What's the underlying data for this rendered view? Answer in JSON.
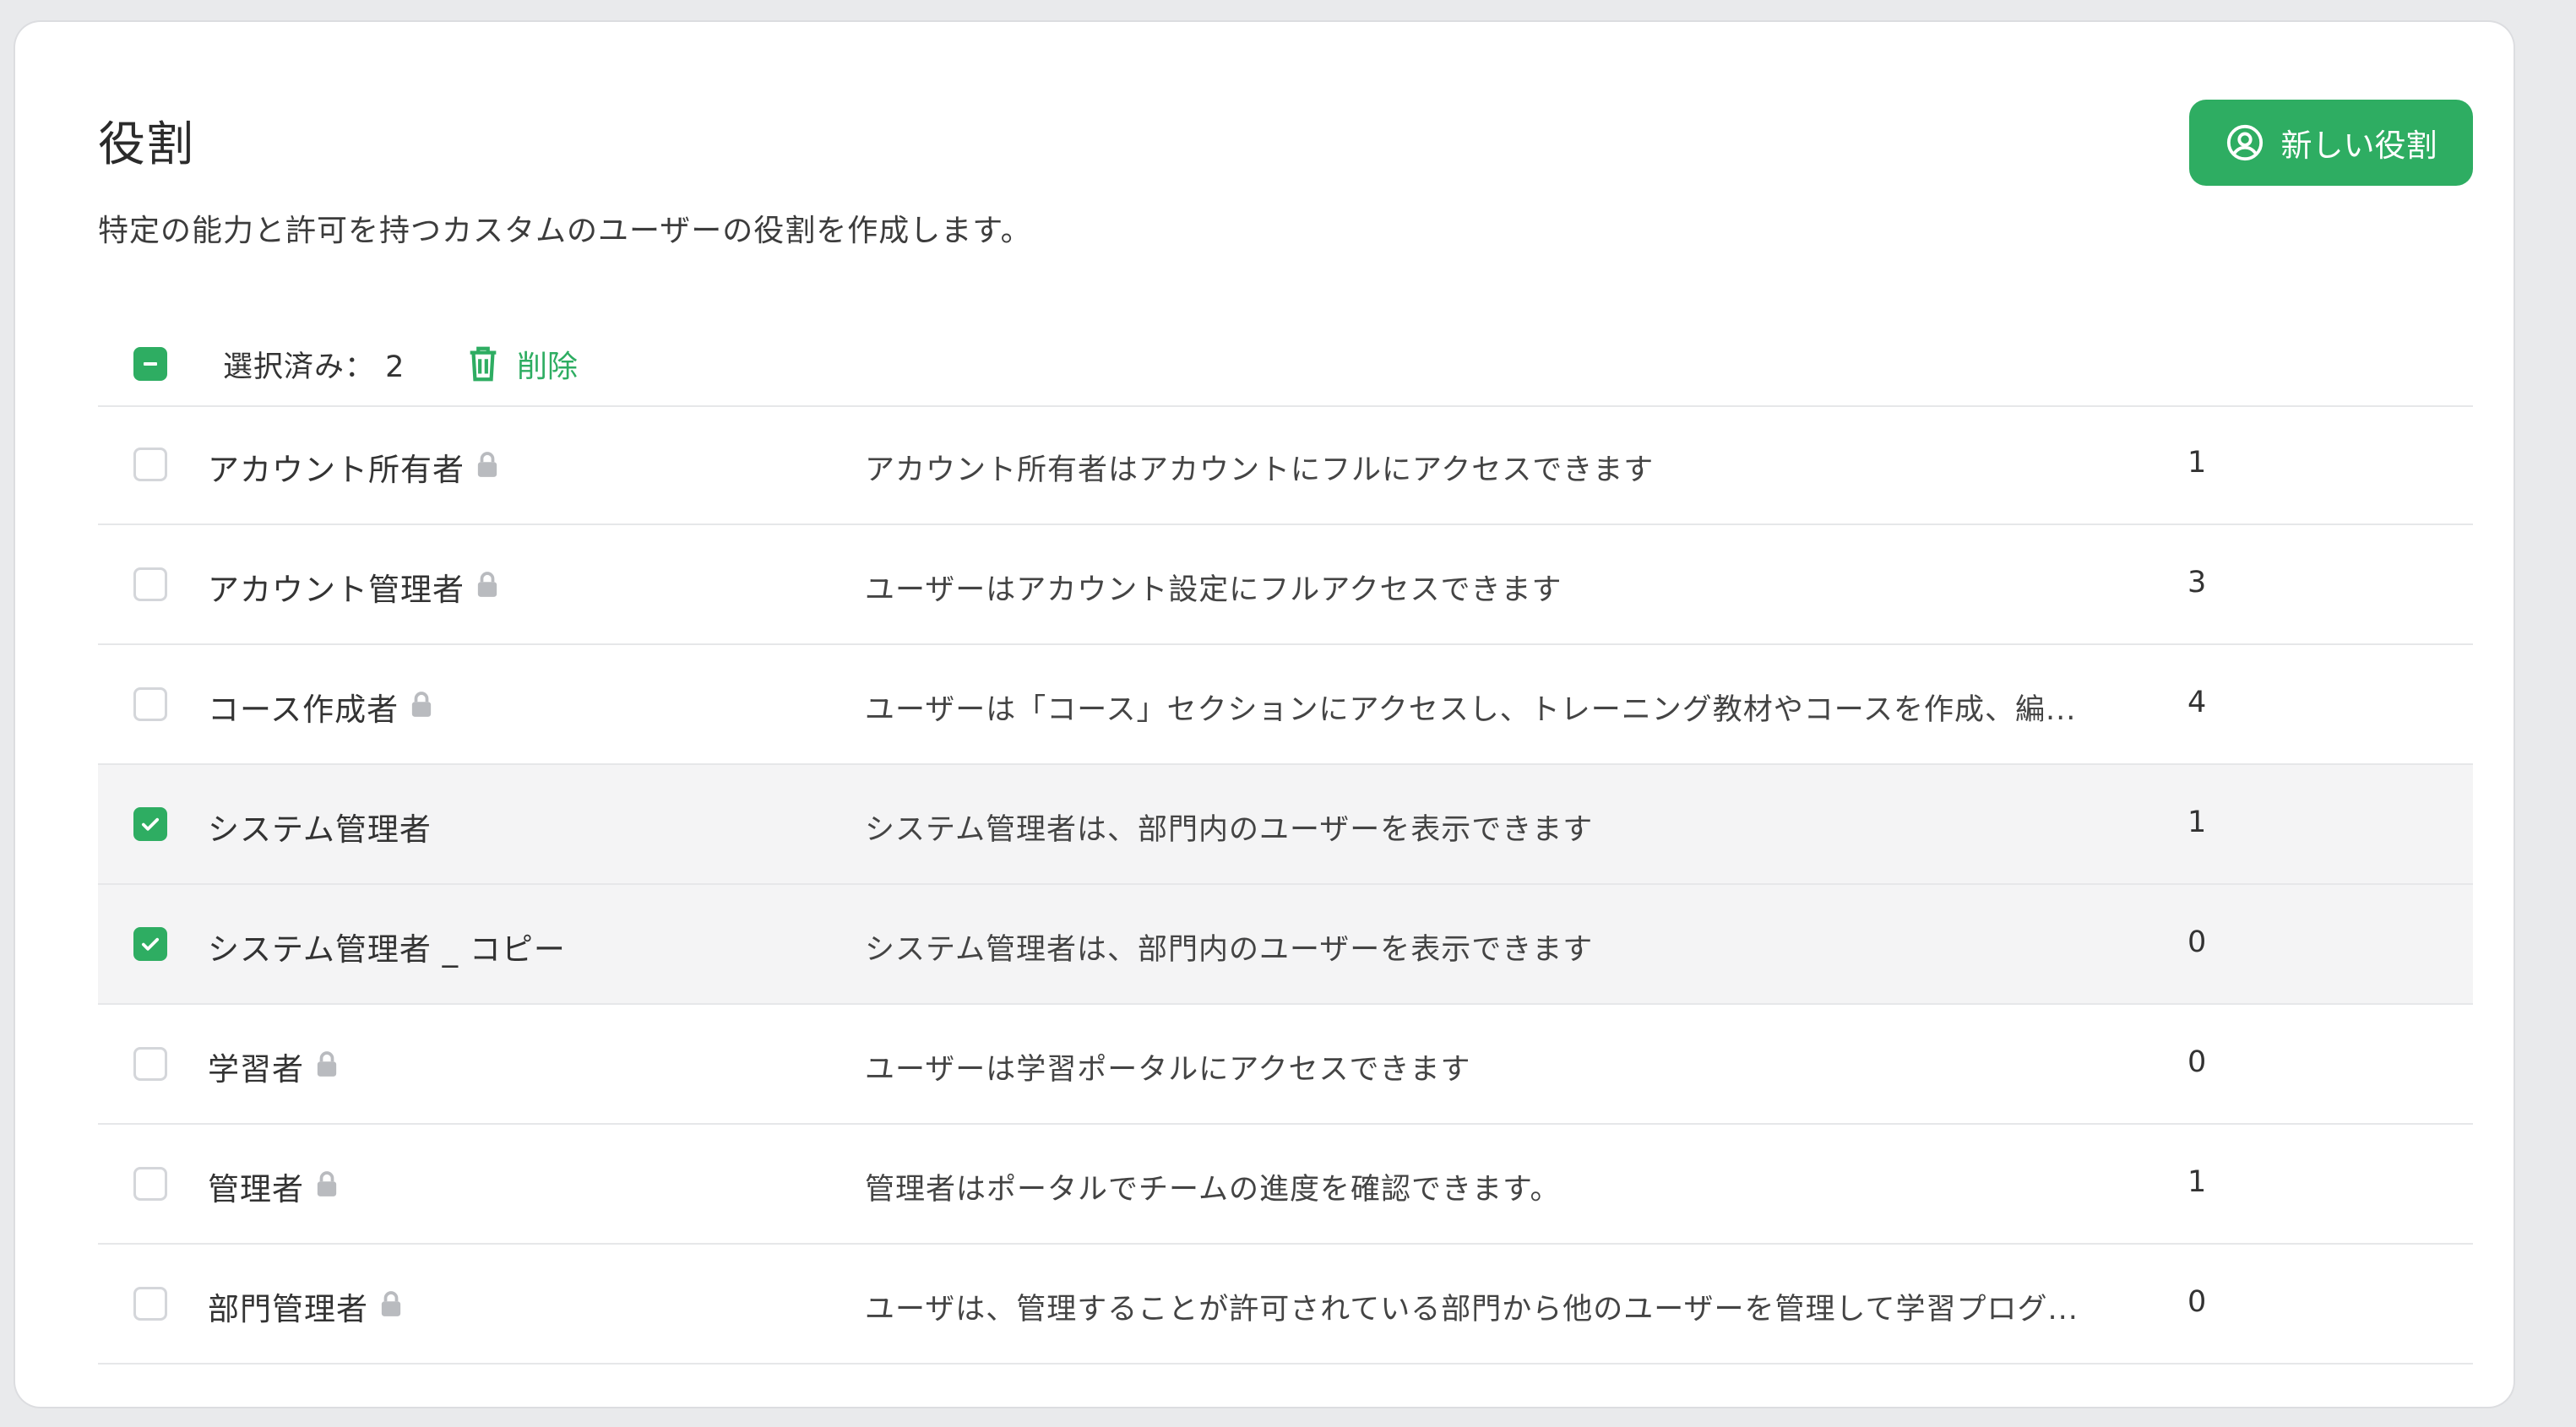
{
  "header": {
    "title": "役割",
    "description": "特定の能力と許可を持つカスタムのユーザーの役割を作成します。",
    "new_role_label": "新しい役割"
  },
  "bulk": {
    "selected_label": "選択済み：",
    "selected_count": "2",
    "delete_label": "削除"
  },
  "roles": [
    {
      "name": "アカウント所有者",
      "locked": true,
      "selected": false,
      "description": "アカウント所有者はアカウントにフルにアクセスできます",
      "count": "1"
    },
    {
      "name": "アカウント管理者",
      "locked": true,
      "selected": false,
      "description": "ユーザーはアカウント設定にフルアクセスできます",
      "count": "3"
    },
    {
      "name": "コース作成者",
      "locked": true,
      "selected": false,
      "description": "ユーザーは「コース」セクションにアクセスし、トレーニング教材やコースを作成、編...",
      "count": "4"
    },
    {
      "name": "システム管理者",
      "locked": false,
      "selected": true,
      "description": "システム管理者は、部門内のユーザーを表示できます",
      "count": "1"
    },
    {
      "name": "システム管理者 _ コピー",
      "locked": false,
      "selected": true,
      "description": "システム管理者は、部門内のユーザーを表示できます",
      "count": "0"
    },
    {
      "name": "学習者",
      "locked": true,
      "selected": false,
      "description": "ユーザーは学習ポータルにアクセスできます",
      "count": "0"
    },
    {
      "name": "管理者",
      "locked": true,
      "selected": false,
      "description": "管理者はポータルでチームの進度を確認できます。",
      "count": "1"
    },
    {
      "name": "部門管理者",
      "locked": true,
      "selected": false,
      "description": "ユーザは、管理することが許可されている部門から他のユーザーを管理して学習プログ...",
      "count": "0"
    }
  ],
  "colors": {
    "accent": "#2ead62",
    "selected_row": "#f4f4f5",
    "lock_icon": "#b9bbbf"
  },
  "icons": {
    "new_role": "user-circle-icon",
    "delete": "trash-icon",
    "lock": "lock-icon",
    "check": "check-icon",
    "minus": "minus-icon"
  }
}
